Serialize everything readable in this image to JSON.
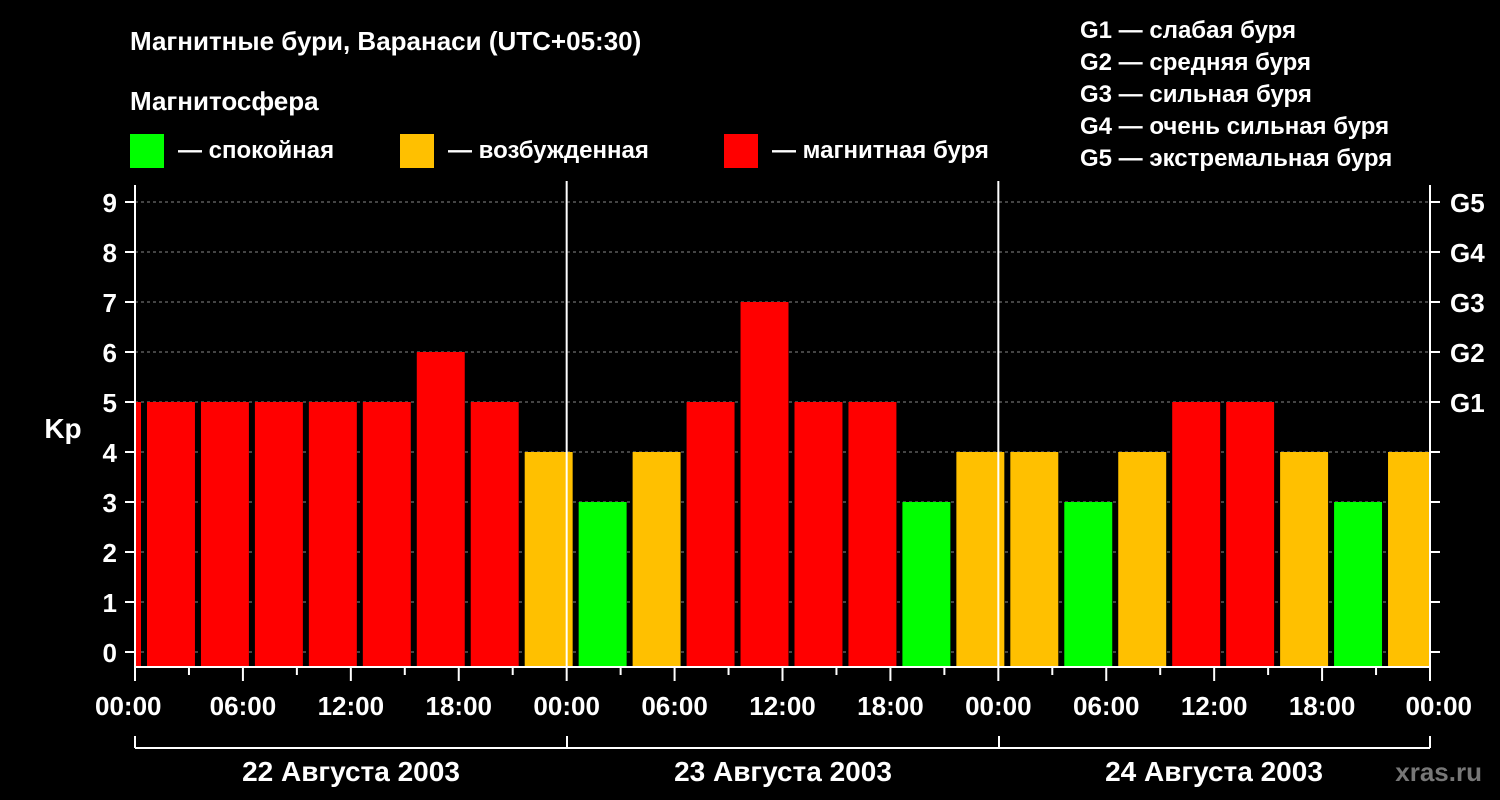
{
  "title": "Магнитные бури, Варанаси (UTC+05:30)",
  "legend_title": "Магнитосфера",
  "legend": [
    {
      "label": "— спокойная",
      "color": "#00ff00"
    },
    {
      "label": "— возбужденная",
      "color": "#ffc000"
    },
    {
      "label": "— магнитная буря",
      "color": "#ff0000"
    }
  ],
  "g_legend": [
    "G1 — слабая буря",
    "G2 — средняя буря",
    "G3 — сильная буря",
    "G4 — очень сильная буря",
    "G5 — экстремальная буря"
  ],
  "watermark": "xras.ru",
  "chart_data": {
    "type": "bar",
    "ylabel": "Kp",
    "ylim": [
      0,
      9
    ],
    "y_ticks": [
      "0",
      "1",
      "2",
      "3",
      "4",
      "5",
      "6",
      "7",
      "8",
      "9"
    ],
    "right_ticks": [
      {
        "value": 5,
        "label": "G1"
      },
      {
        "value": 6,
        "label": "G2"
      },
      {
        "value": 7,
        "label": "G3"
      },
      {
        "value": 8,
        "label": "G4"
      },
      {
        "value": 9,
        "label": "G5"
      }
    ],
    "x_tick_labels": [
      "00:00",
      "06:00",
      "12:00",
      "18:00",
      "00:00",
      "06:00",
      "12:00",
      "18:00",
      "00:00",
      "06:00",
      "12:00",
      "18:00",
      "00:00"
    ],
    "days": [
      "22 Августа 2003",
      "23 Августа 2003",
      "24 Августа 2003"
    ],
    "interval_hours": 3,
    "first_bar_start_hour": -2.5,
    "values": [
      5,
      5,
      5,
      5,
      5,
      5,
      6,
      5,
      4,
      3,
      4,
      5,
      7,
      5,
      5,
      3,
      4,
      4,
      3,
      4,
      5,
      5,
      4,
      3,
      4
    ],
    "levels": [
      "storm",
      "storm",
      "storm",
      "storm",
      "storm",
      "storm",
      "storm",
      "storm",
      "active",
      "quiet",
      "active",
      "storm",
      "storm",
      "storm",
      "storm",
      "quiet",
      "active",
      "active",
      "quiet",
      "active",
      "storm",
      "storm",
      "active",
      "quiet",
      "active"
    ],
    "colors": {
      "quiet": "#00ff00",
      "active": "#ffc000",
      "storm": "#ff0000"
    },
    "grid": true
  }
}
